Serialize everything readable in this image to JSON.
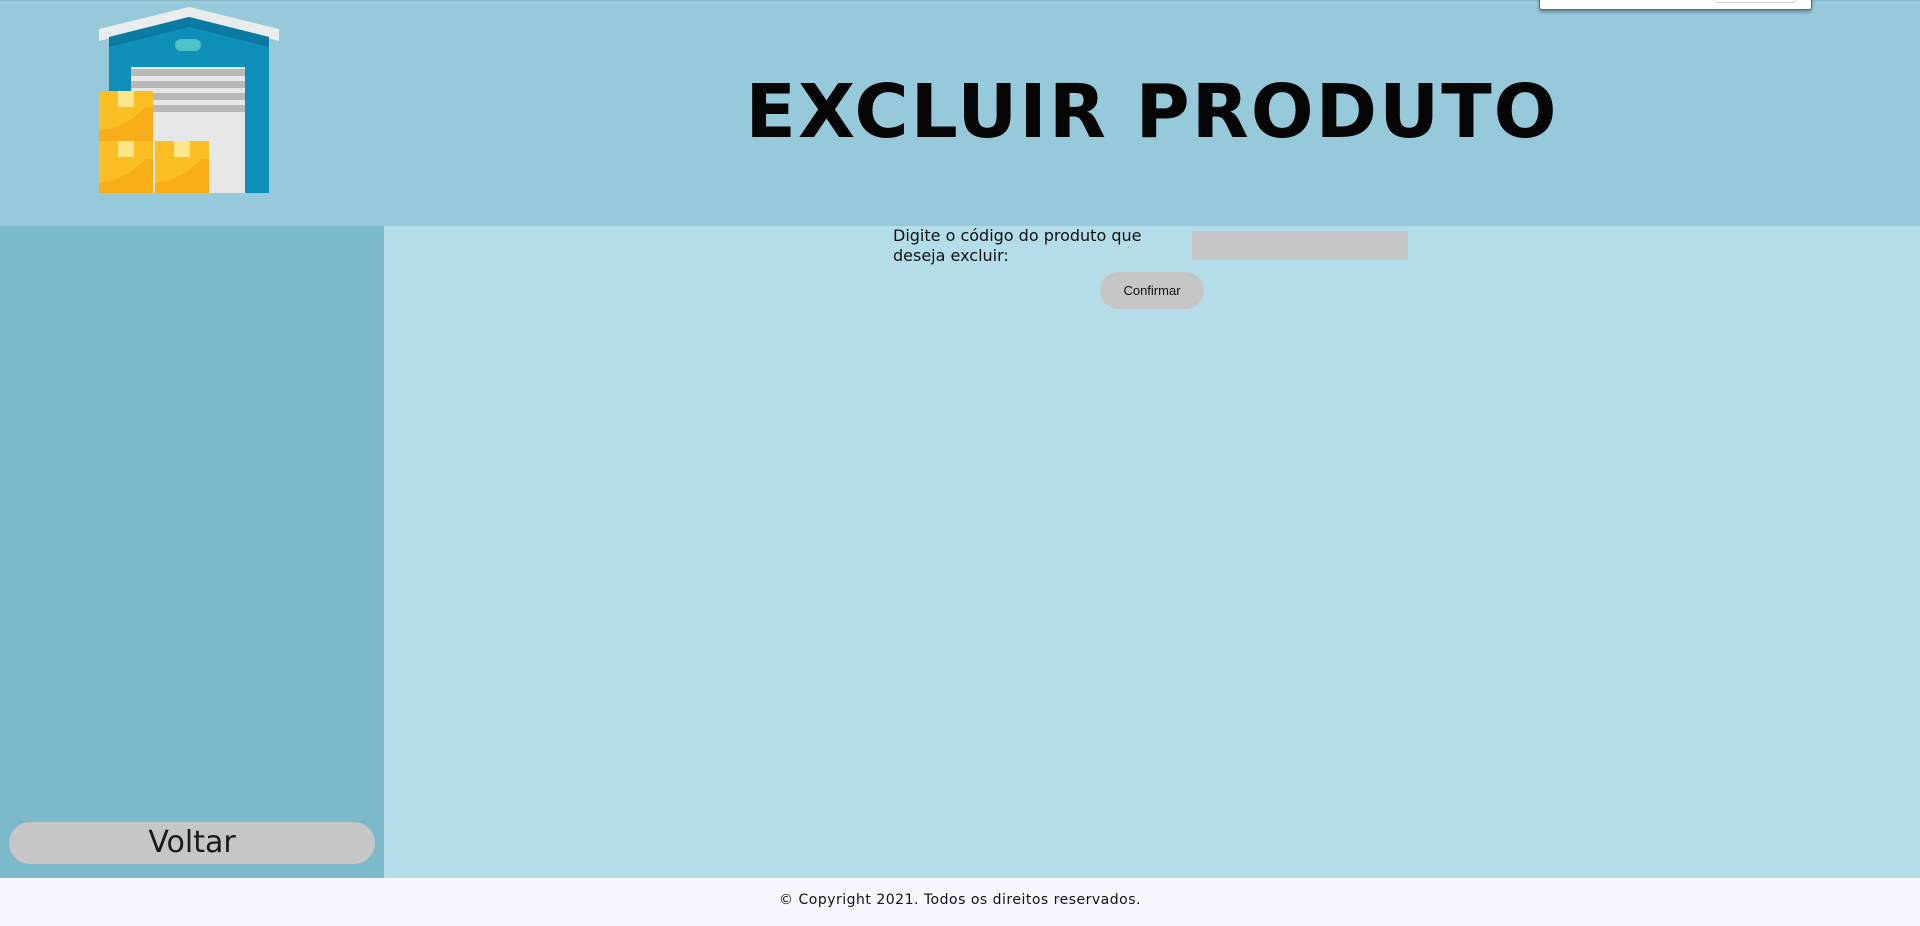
{
  "header": {
    "title": "EXCLUIR PRODUTO",
    "logo_icon": "warehouse-icon"
  },
  "sidebar": {
    "back_label": "Voltar"
  },
  "form": {
    "label": "Digite o código do produto que deseja excluir:",
    "code_value": "",
    "confirm_label": "Confirmar"
  },
  "footer": {
    "copyright": "© Copyright 2021. Todos os direitos reservados."
  },
  "colors": {
    "header_bg": "#96cadb",
    "sidebar_bg": "#7abaca",
    "main_bg": "#b2dde9",
    "button_bg": "#c6c6c6",
    "footer_bg": "#f8f6ff"
  }
}
